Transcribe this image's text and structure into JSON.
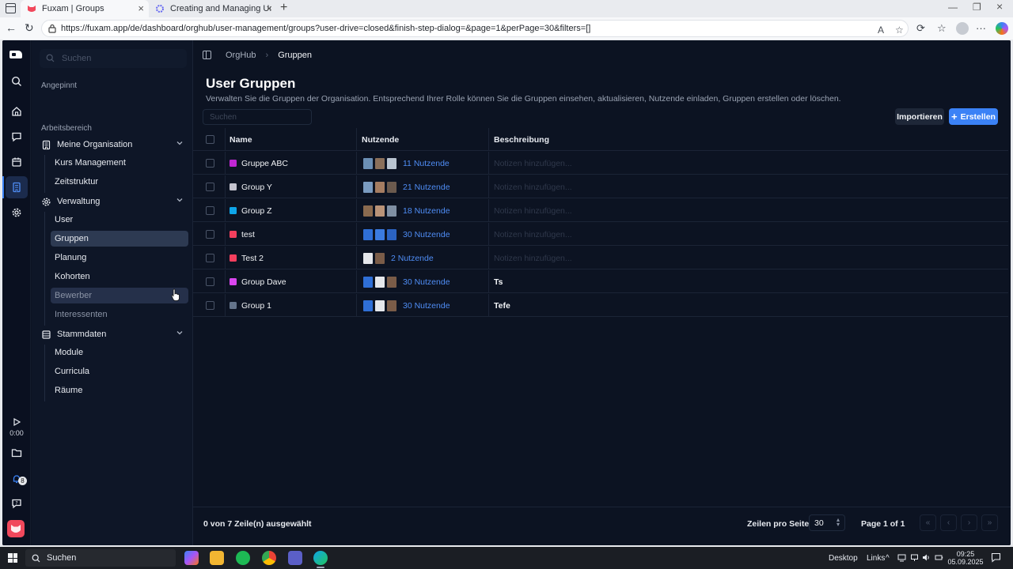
{
  "browser": {
    "tabs": [
      {
        "title": "Fuxam | Groups",
        "active": true
      },
      {
        "title": "Creating and Managing User Gro",
        "active": false
      }
    ],
    "url": "https://fuxam.app/de/dashboard/orghub/user-management/groups?user-drive=closed&finish-step-dialog=&page=1&perPage=30&filters=[]"
  },
  "sidebar": {
    "search_placeholder": "Suchen",
    "pinned_label": "Angepinnt",
    "workspace_label": "Arbeitsbereich",
    "groups": [
      {
        "label": "Meine Organisation",
        "icon": "building-icon",
        "items": [
          "Kurs Management",
          "Zeitstruktur"
        ]
      },
      {
        "label": "Verwaltung",
        "icon": "gear-icon",
        "items": [
          "User",
          "Gruppen",
          "Planung",
          "Kohorten",
          "Bewerber",
          "Interessenten"
        ]
      },
      {
        "label": "Stammdaten",
        "icon": "database-icon",
        "items": [
          "Module",
          "Curricula",
          "Räume"
        ]
      }
    ],
    "active_item": "Gruppen",
    "hover_item": "Bewerber"
  },
  "rail": {
    "icons": [
      "search-icon",
      "home-icon",
      "chat-icon",
      "calendar-icon",
      "orghub-icon",
      "settings-icon"
    ],
    "recorder_time": "0:00",
    "notification_count": "8"
  },
  "breadcrumb": {
    "root": "OrgHub",
    "current": "Gruppen"
  },
  "page": {
    "title": "User Gruppen",
    "subtitle": "Verwalten Sie die Gruppen der Organisation. Entsprechend Ihrer Rolle können Sie die Gruppen einsehen, aktualisieren, Nutzende einladen, Gruppen erstellen oder löschen.",
    "search_placeholder": "Suchen",
    "import_label": "Importieren",
    "create_label": "Erstellen"
  },
  "table": {
    "columns": {
      "name": "Name",
      "users": "Nutzende",
      "description": "Beschreibung"
    },
    "rows": [
      {
        "color": "#c026d3",
        "name": "Gruppe ABC",
        "users": "11 Nutzende",
        "description": "Notizen hinzufügen...",
        "has_description": false,
        "avatars": [
          "#6b8fb5",
          "#8a6f5a",
          "#b9c4d1"
        ]
      },
      {
        "color": "#c4c4cf",
        "name": "Group Y",
        "users": "21 Nutzende",
        "description": "Notizen hinzufügen...",
        "has_description": false,
        "avatars": [
          "#7a9bc0",
          "#a57d62",
          "#6b5a4e"
        ]
      },
      {
        "color": "#0ea5e9",
        "name": "Group Z",
        "users": "18 Nutzende",
        "description": "Notizen hinzufügen...",
        "has_description": false,
        "avatars": [
          "#8a6a4f",
          "#b99378",
          "#7f8fa3"
        ]
      },
      {
        "color": "#f43f5e",
        "name": "test",
        "users": "30 Nutzende",
        "description": "Notizen hinzufügen...",
        "has_description": false,
        "avatars": [
          "#2f6fd6",
          "#3b7be0",
          "#2b63c2"
        ]
      },
      {
        "color": "#f43f5e",
        "name": "Test 2",
        "users": "2 Nutzende",
        "description": "Notizen hinzufügen...",
        "has_description": false,
        "avatars": [
          "#e5e7eb",
          "#7a5c48"
        ]
      },
      {
        "color": "#d946ef",
        "name": "Group Dave",
        "users": "30 Nutzende",
        "description": "Ts",
        "has_description": true,
        "avatars": [
          "#2f6fd6",
          "#e5e7eb",
          "#7a5c48"
        ]
      },
      {
        "color": "#64748b",
        "name": "Group 1",
        "users": "30 Nutzende",
        "description": "Tefe",
        "has_description": true,
        "avatars": [
          "#2f6fd6",
          "#e5e7eb",
          "#7a5c48"
        ]
      }
    ]
  },
  "footer": {
    "selection": "0 von 7 Zeile(n) ausgewählt",
    "rows_per_page_label": "Zeilen pro Seite",
    "rows_per_page_value": "30",
    "page_label": "Page 1 of 1"
  },
  "taskbar": {
    "search_label": "Suchen",
    "desktop_label": "Desktop",
    "links_label": "Links",
    "time": "09:25",
    "date": "05.09.2025"
  }
}
